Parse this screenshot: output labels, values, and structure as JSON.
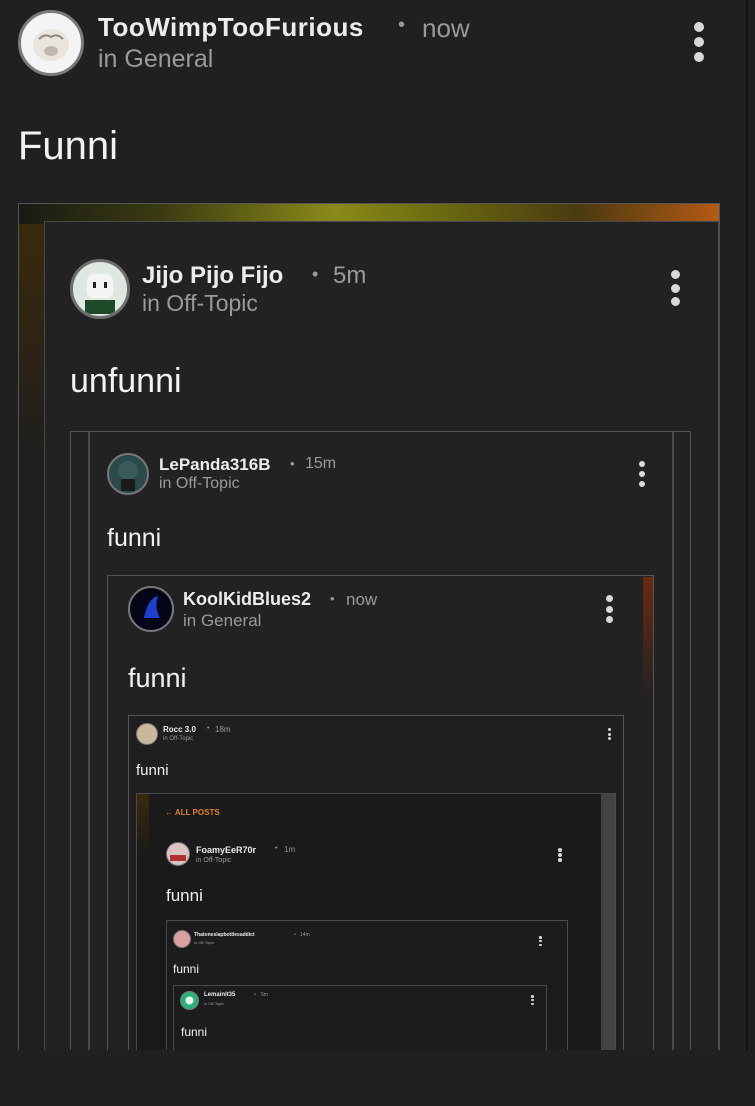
{
  "posts": [
    {
      "author": "TooWimpTooFurious",
      "sep": "•",
      "time": "now",
      "category": "in General",
      "title": "Funni"
    },
    {
      "author": "Jijo Pijo Fijo",
      "sep": "•",
      "time": "5m",
      "category": "in Off-Topic",
      "title": "unfunni"
    },
    {
      "author": "LePanda316B",
      "sep": "•",
      "time": "15m",
      "category": "in Off-Topic",
      "title": "funni"
    },
    {
      "author": "KoolKidBlues2",
      "sep": "•",
      "time": "now",
      "category": "in General",
      "title": "funni"
    },
    {
      "author": "Rocc 3.0",
      "sep": "•",
      "time": "18m",
      "category": "in Off-Topic",
      "title": "funni"
    },
    {
      "author": "FoamyEeR70r",
      "sep": "•",
      "time": "1m",
      "category": "in Off-Topic",
      "title": "funni"
    },
    {
      "author": "Thatoneslapbottlesaddict",
      "sep": "•",
      "time": "14m",
      "category": "in Off-Topic",
      "title": "funni"
    },
    {
      "author": "Lemainit35",
      "sep": "•",
      "time": "5m",
      "category": "in Off-Topic",
      "title": "funni"
    }
  ],
  "nav": {
    "all_posts": "← ALL POSTS"
  },
  "icons": {
    "more": "kebab-menu-icon"
  },
  "colors": {
    "background": "#202020",
    "accent_orange": "#d9822b",
    "banner_yellow": "#8a8a1a"
  }
}
